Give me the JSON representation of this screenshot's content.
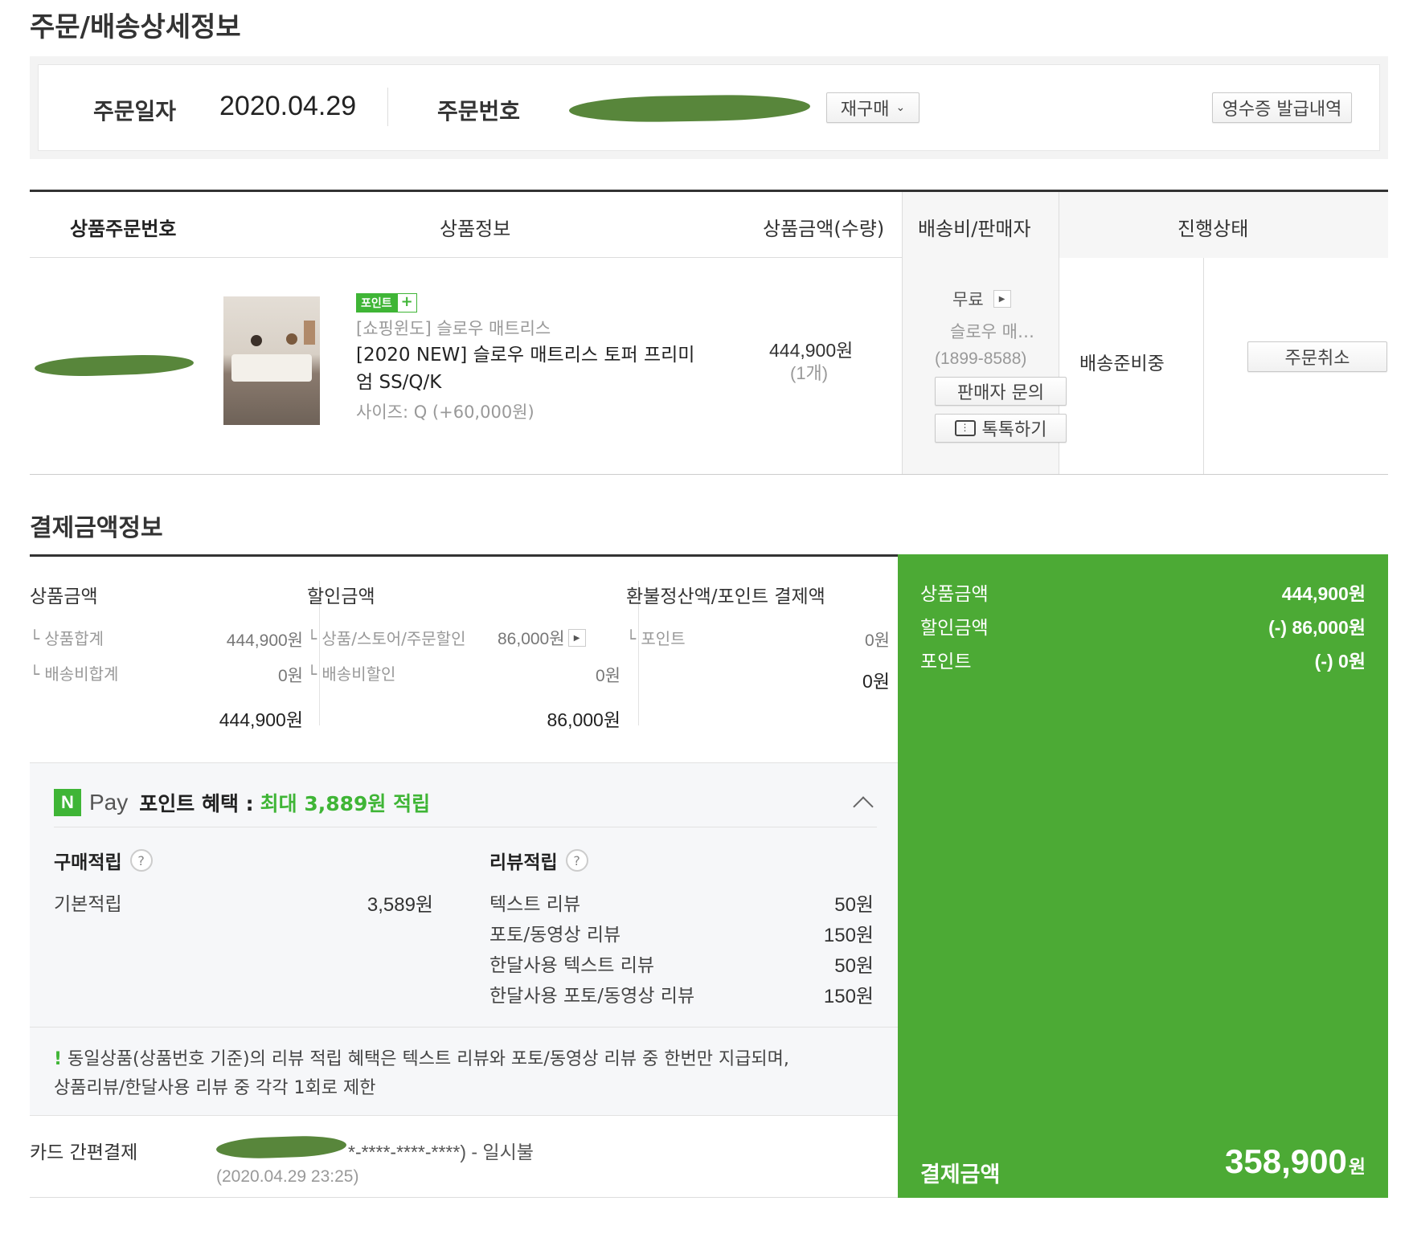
{
  "page": {
    "title": "주문/배송상세정보"
  },
  "order": {
    "date_label": "주문일자",
    "date_value": "2020.04.29",
    "number_label": "주문번호",
    "reorder_button": "재구매",
    "receipt_button": "영수증 발급내역"
  },
  "table": {
    "headers": [
      "상품주문번호",
      "상품정보",
      "상품금액(수량)",
      "배송비/판매자",
      "진행상태"
    ],
    "item": {
      "badge": "포인트",
      "store": "[쇼핑윈도] 슬로우 매트리스",
      "name": "[2020 NEW] 슬로우 매트리스 토퍼 프리미엄 SS/Q/K",
      "option": "사이즈: Q (+60,000원)",
      "price": "444,900원",
      "quantity": "(1개)",
      "shipping": "무료",
      "seller": "슬로우 매…",
      "phone": "(1899-8588)",
      "inquiry_button": "판매자 문의",
      "talk_button": "톡톡하기",
      "status": "배송준비중",
      "cancel_button": "주문취소"
    }
  },
  "payment": {
    "section_title": "결제금액정보",
    "product": {
      "title": "상품금액",
      "rows": [
        {
          "label": "상품합계",
          "value": "444,900원"
        },
        {
          "label": "배송비합계",
          "value": "0원"
        }
      ],
      "total": "444,900원"
    },
    "discount": {
      "title": "할인금액",
      "rows": [
        {
          "label": "상품/스토어/주문할인",
          "value": "86,000원"
        },
        {
          "label": "배송비할인",
          "value": "0원"
        }
      ],
      "total": "86,000원"
    },
    "refund": {
      "title": "환불정산액/포인트 결제액",
      "rows": [
        {
          "label": "포인트",
          "value": "0원"
        }
      ],
      "total": "0원"
    },
    "summary": {
      "rows": [
        {
          "label": "상품금액",
          "value": "444,900원"
        },
        {
          "label": "할인금액",
          "value": "(-) 86,000원"
        },
        {
          "label": "포인트",
          "value": "(-) 0원"
        }
      ],
      "total_label": "결제금액",
      "total_value": "358,900",
      "total_unit": "원"
    },
    "method_label": "카드 간편결제",
    "method_value": "*-****-****-****) - 일시불",
    "method_time": "(2020.04.29 23:25)"
  },
  "npay": {
    "logo_n": "N",
    "logo_pay": "Pay",
    "benefit_label": "포인트 혜택 :",
    "benefit_value": "최대 3,889원 적립",
    "purchase_title": "구매적립",
    "purchase_rows": [
      {
        "label": "기본적립",
        "value": "3,589원"
      }
    ],
    "review_title": "리뷰적립",
    "review_rows": [
      {
        "label": "텍스트 리뷰",
        "value": "50원"
      },
      {
        "label": "포토/동영상 리뷰",
        "value": "150원"
      },
      {
        "label": "한달사용 텍스트 리뷰",
        "value": "50원"
      },
      {
        "label": "한달사용 포토/동영상 리뷰",
        "value": "150원"
      }
    ],
    "notice_mark": "!",
    "notice_line1": "동일상품(상품번호 기준)의 리뷰 적립 혜택은 텍스트 리뷰와 포토/동영상 리뷰 중 한번만 지급되며,",
    "notice_line2": "상품리뷰/한달사용 리뷰 중 각각 1회로 제한"
  },
  "colors": {
    "brand_green": "#4caa35",
    "text_green": "#3fb536",
    "border_dark": "#333333"
  },
  "icons": {
    "arrow": "arrow-right-icon",
    "chevron": "chevron-up-icon",
    "help": "help-icon",
    "talk": "talk-icon"
  }
}
